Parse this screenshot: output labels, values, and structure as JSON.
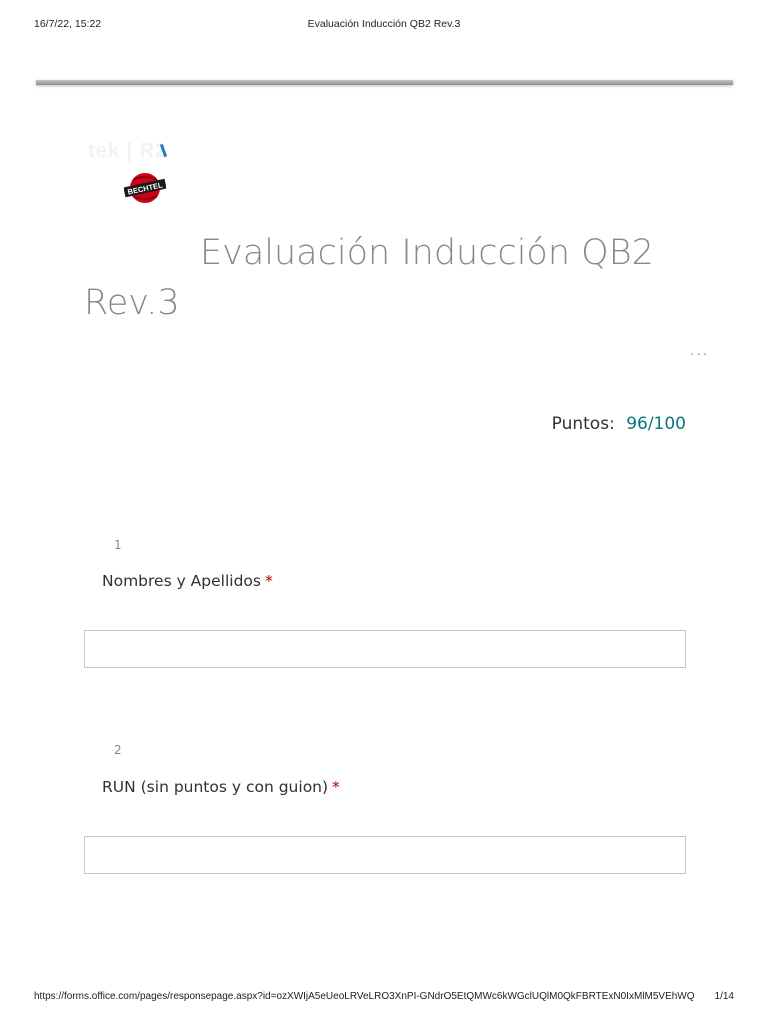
{
  "print_header": {
    "timestamp": "16/7/22, 15:22",
    "document_title": "Evaluación Inducción QB2 Rev.3"
  },
  "logos": {
    "brand_text": "tek | R2",
    "bechtel_text": "BECHTEL"
  },
  "form": {
    "title_line1": "Evaluación Inducción QB2",
    "title_line2": "Rev.3",
    "more_options": "...",
    "score_label": "Puntos:",
    "score_value": "96/100"
  },
  "questions": [
    {
      "number": "1",
      "title": "Nombres y Apellidos",
      "required_mark": "*",
      "answer": ""
    },
    {
      "number": "2",
      "title": "RUN (sin puntos y con guion)",
      "required_mark": "*",
      "answer": ""
    }
  ],
  "print_footer": {
    "url": "https://forms.office.com/pages/responsepage.aspx?id=ozXWIjA5eUeoLRVeLRO3XnPI-GNdrO5EtQMWc6kWGclUQlM0QkFBRTExN0IxMlM5VEhWQ...",
    "page": "1/14"
  },
  "colors": {
    "accent": "#03787c",
    "required": "#a80000",
    "title_gray": "#8a8886",
    "bechtel_red": "#d0021b"
  }
}
